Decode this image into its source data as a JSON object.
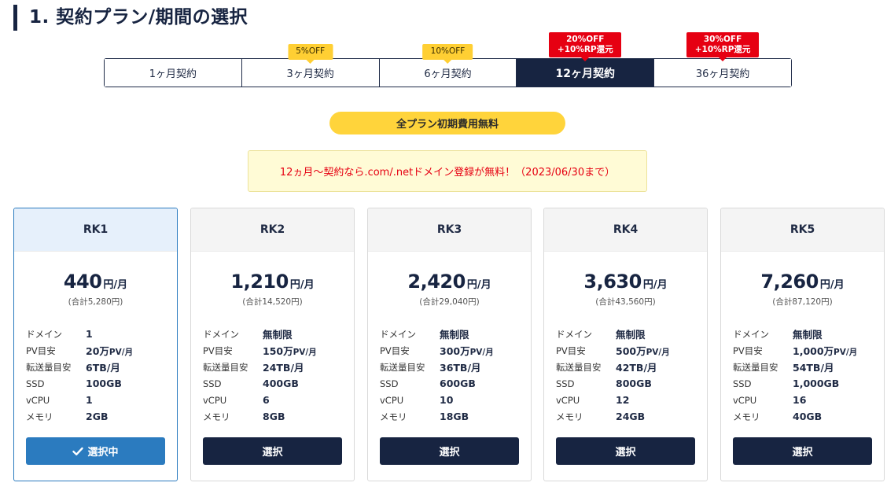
{
  "section": {
    "title": "1. 契約プラン/期間の選択"
  },
  "period_tabs": [
    {
      "label": "1ヶ月契約",
      "badge": null,
      "active": false
    },
    {
      "label": "3ヶ月契約",
      "badge": {
        "line1": "5%OFF",
        "line2": "",
        "style": "yellow"
      },
      "active": false
    },
    {
      "label": "6ヶ月契約",
      "badge": {
        "line1": "10%OFF",
        "line2": "",
        "style": "yellow"
      },
      "active": false
    },
    {
      "label": "12ヶ月契約",
      "badge": {
        "line1": "20%OFF",
        "line2": "+10%RP還元",
        "style": "red"
      },
      "active": true
    },
    {
      "label": "36ヶ月契約",
      "badge": {
        "line1": "30%OFF",
        "line2": "+10%RP還元",
        "style": "red"
      },
      "active": false
    }
  ],
  "free_pill": "全プラン初期費用無料",
  "notice": "12ヵ月〜契約なら.com/.netドメイン登録が無料！（2023/06/30まで）",
  "plans": [
    {
      "name": "RK1",
      "price": "440",
      "unit": "円/月",
      "total": "(合計5,280円)",
      "specs": [
        {
          "label": "ドメイン",
          "value": "1"
        },
        {
          "label": "PV目安",
          "value": "20万",
          "suffix": "PV/月"
        },
        {
          "label": "転送量目安",
          "value": "6TB/月"
        },
        {
          "label": "SSD",
          "value": "100GB"
        },
        {
          "label": "vCPU",
          "value": "1"
        },
        {
          "label": "メモリ",
          "value": "2GB"
        }
      ],
      "button": "選択中",
      "selected": true
    },
    {
      "name": "RK2",
      "price": "1,210",
      "unit": "円/月",
      "total": "(合計14,520円)",
      "specs": [
        {
          "label": "ドメイン",
          "value": "無制限"
        },
        {
          "label": "PV目安",
          "value": "150万",
          "suffix": "PV/月"
        },
        {
          "label": "転送量目安",
          "value": "24TB/月"
        },
        {
          "label": "SSD",
          "value": "400GB"
        },
        {
          "label": "vCPU",
          "value": "6"
        },
        {
          "label": "メモリ",
          "value": "8GB"
        }
      ],
      "button": "選択",
      "selected": false
    },
    {
      "name": "RK3",
      "price": "2,420",
      "unit": "円/月",
      "total": "(合計29,040円)",
      "specs": [
        {
          "label": "ドメイン",
          "value": "無制限"
        },
        {
          "label": "PV目安",
          "value": "300万",
          "suffix": "PV/月"
        },
        {
          "label": "転送量目安",
          "value": "36TB/月"
        },
        {
          "label": "SSD",
          "value": "600GB"
        },
        {
          "label": "vCPU",
          "value": "10"
        },
        {
          "label": "メモリ",
          "value": "18GB"
        }
      ],
      "button": "選択",
      "selected": false
    },
    {
      "name": "RK4",
      "price": "3,630",
      "unit": "円/月",
      "total": "(合計43,560円)",
      "specs": [
        {
          "label": "ドメイン",
          "value": "無制限"
        },
        {
          "label": "PV目安",
          "value": "500万",
          "suffix": "PV/月"
        },
        {
          "label": "転送量目安",
          "value": "42TB/月"
        },
        {
          "label": "SSD",
          "value": "800GB"
        },
        {
          "label": "vCPU",
          "value": "12"
        },
        {
          "label": "メモリ",
          "value": "24GB"
        }
      ],
      "button": "選択",
      "selected": false
    },
    {
      "name": "RK5",
      "price": "7,260",
      "unit": "円/月",
      "total": "(合計87,120円)",
      "specs": [
        {
          "label": "ドメイン",
          "value": "無制限"
        },
        {
          "label": "PV目安",
          "value": "1,000万",
          "suffix": "PV/月"
        },
        {
          "label": "転送量目安",
          "value": "54TB/月"
        },
        {
          "label": "SSD",
          "value": "1,000GB"
        },
        {
          "label": "vCPU",
          "value": "16"
        },
        {
          "label": "メモリ",
          "value": "40GB"
        }
      ],
      "button": "選択",
      "selected": false
    }
  ],
  "colors": {
    "navy": "#172441",
    "selected_blue": "#2b7bbf",
    "badge_yellow": "#ffcf33",
    "badge_red": "#e60012",
    "notice_bg": "#fffbd6",
    "notice_text": "#e60012"
  },
  "icons": {
    "selected_button": "check-icon"
  }
}
